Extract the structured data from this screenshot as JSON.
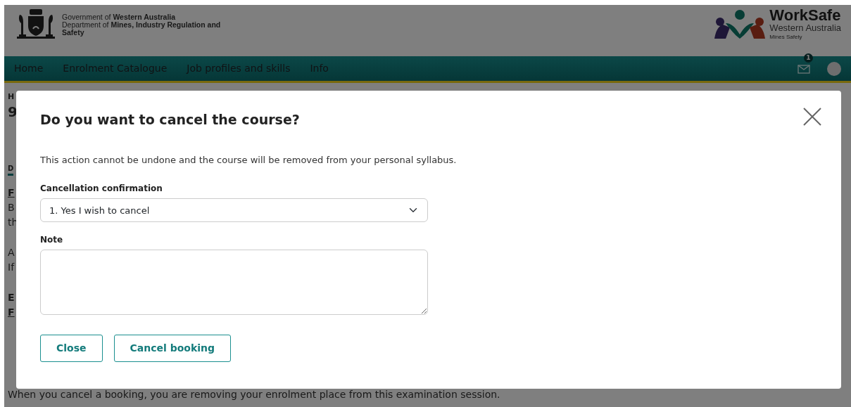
{
  "header": {
    "government": "Government of **Western Australia**",
    "department": "Department of **Mines, Industry Regulation and Safety**",
    "brand": "WorkSafe",
    "brand_region": "Western Australia",
    "brand_sub": "Mines Safety"
  },
  "nav": {
    "items": [
      "Home",
      "Enrolment Catalogue",
      "Job profiles and skills",
      "Info"
    ],
    "messages_badge": "1"
  },
  "background": [
    {
      "kind": "crumb",
      "text": "H"
    },
    {
      "kind": "title",
      "text": "9"
    },
    {
      "kind": "tab",
      "text": "D"
    },
    {
      "kind": "link",
      "text": "F"
    },
    {
      "kind": "para",
      "text": "B"
    },
    {
      "kind": "para",
      "text": "th"
    },
    {
      "kind": "para",
      "text": "A"
    },
    {
      "kind": "para",
      "text": "If"
    },
    {
      "kind": "bold",
      "text": "E"
    },
    {
      "kind": "link",
      "text": "F"
    },
    {
      "kind": "footer",
      "text": "When you cancel a booking, you are removing your enrolment place from this examination session."
    }
  ],
  "modal": {
    "title": "Do you want to cancel the course?",
    "message": "This action cannot be undone and the course will be removed from your personal syllabus.",
    "fields": [
      {
        "kind": "select",
        "label": "Cancellation confirmation",
        "value": "1. Yes I wish to cancel"
      },
      {
        "kind": "textarea",
        "label": "Note"
      }
    ],
    "buttons": [
      "Close",
      "Cancel booking"
    ]
  }
}
